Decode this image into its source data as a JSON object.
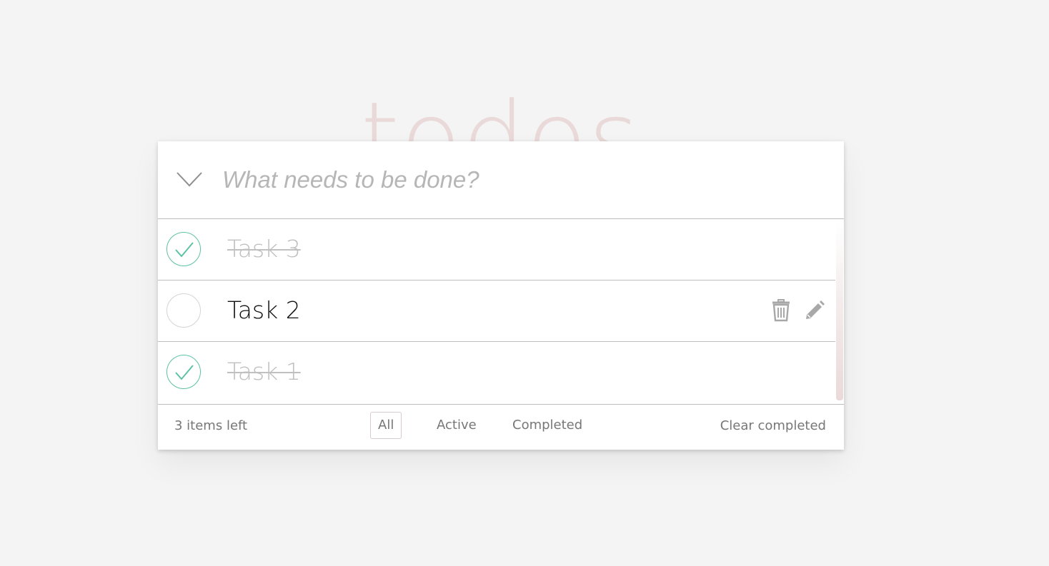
{
  "header": {
    "title": "todos",
    "new_todo_placeholder": "What needs to be done?"
  },
  "todos": [
    {
      "label": "Task 3",
      "completed": true
    },
    {
      "label": "Task 2",
      "completed": false
    },
    {
      "label": "Task 1",
      "completed": true
    }
  ],
  "footer": {
    "items_left": "3 items left",
    "filters": [
      {
        "label": "All",
        "selected": true
      },
      {
        "label": "Active",
        "selected": false
      },
      {
        "label": "Completed",
        "selected": false
      }
    ],
    "clear_completed": "Clear completed"
  },
  "colors": {
    "background": "#f4f4f4",
    "title": "#ead9d9",
    "check_accent": "#5dc2a5",
    "completed_text": "#c0c0c0"
  },
  "icons": {
    "toggle_all": "chevron-down-icon",
    "check": "checkmark-icon",
    "delete": "trash-icon",
    "edit": "pencil-icon"
  }
}
